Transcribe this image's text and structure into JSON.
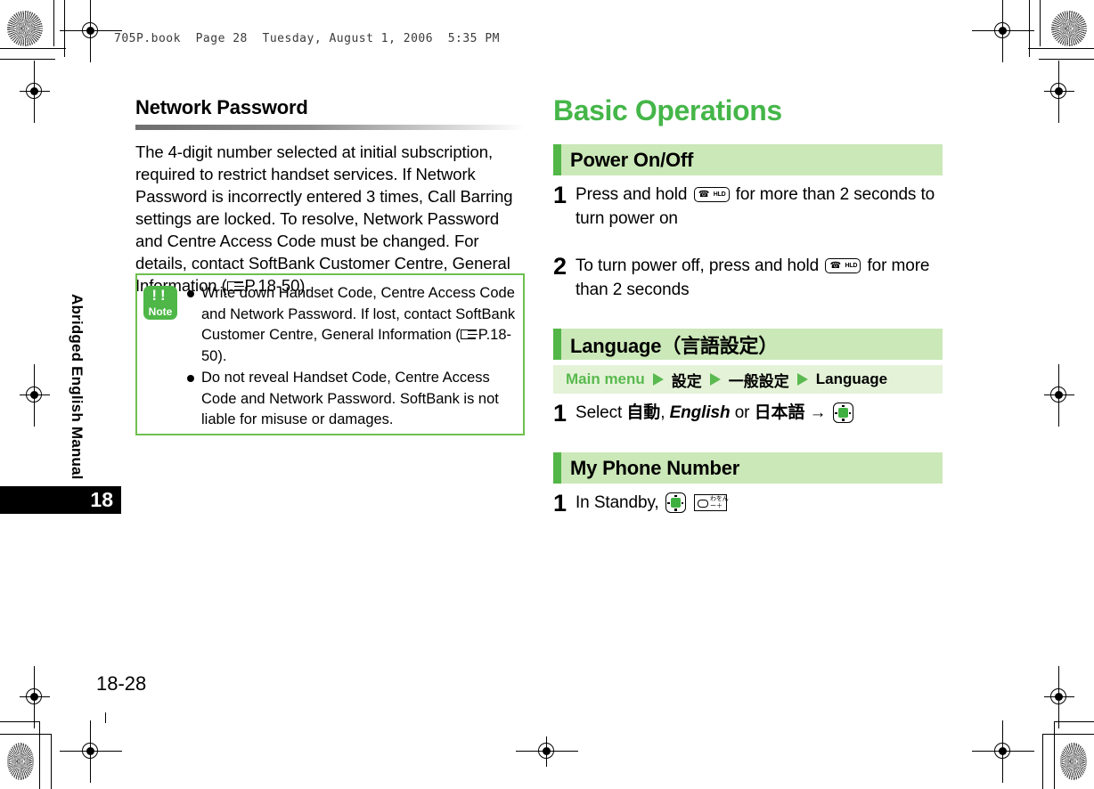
{
  "page": {
    "running_header": "705P.book  Page 28  Tuesday, August 1, 2006  5:35 PM",
    "folio": "18-28",
    "side_tab_label": "Abridged English Manual",
    "side_tab_number": "18",
    "accent_green": "#45b649",
    "band_green": "#cbe8b8",
    "tick_green": "#53b748",
    "crumb_green": "#e4f3d8",
    "note_border_green": "#6fbf4f",
    "note_icon_green": "#4eb748"
  },
  "left_column": {
    "section_title": "Network Password",
    "body_part1": "The 4-digit number selected at initial subscription, required to restrict handset services. If Network Password is incorrectly entered 3 times, Call Barring settings are locked. To resolve, Network Password and Centre Access Code must be changed. For details, contact SoftBank Customer Centre, General Information (",
    "body_ref": "P.18-50",
    "body_part2": ").",
    "note": {
      "icon_bangs": "!!",
      "icon_label": "Note",
      "items": [
        {
          "text_before_ref": "Write down Handset Code, Centre Access Code and Network Password. If lost, contact SoftBank Customer Centre, General Information (",
          "ref": "P.18-50",
          "text_after_ref": ")."
        },
        {
          "text_before_ref": "Do not reveal Handset Code, Centre Access Code and Network Password. SoftBank is not liable for misuse or damages.",
          "ref": "",
          "text_after_ref": ""
        }
      ]
    }
  },
  "right_column": {
    "chapter_title": "Basic Operations",
    "sections": [
      {
        "band_title": "Power On/Off",
        "steps": [
          {
            "number": "1",
            "text_before": "Press and hold",
            "key": "hld-key",
            "text_after": "for more than 2 seconds to turn power on"
          },
          {
            "number": "2",
            "text_before": "To turn power off, press and hold",
            "key": "hld-key",
            "text_after": "for more than 2 seconds"
          }
        ]
      },
      {
        "band_title_en": "Language",
        "band_title_jp": "（言語設定）",
        "breadcrumb": {
          "root": "Main menu",
          "items": [
            "設定",
            "一般設定",
            "Language"
          ]
        },
        "step": {
          "number": "1",
          "select_label": "Select",
          "option_auto": "自動",
          "comma": ",",
          "option_english": "English",
          "or_label": "or",
          "option_japanese": "日本語",
          "arrow": "→"
        }
      },
      {
        "band_title": "My Phone Number",
        "step": {
          "number": "1",
          "text": "In Standby,"
        }
      }
    ]
  },
  "key_icons": {
    "hld": {
      "glyph": "☎",
      "label": "HLD"
    },
    "center": {
      "name": "center-select-key"
    },
    "zero": {
      "kana_top": "わをん",
      "kana_bottom": "ー＋"
    }
  }
}
